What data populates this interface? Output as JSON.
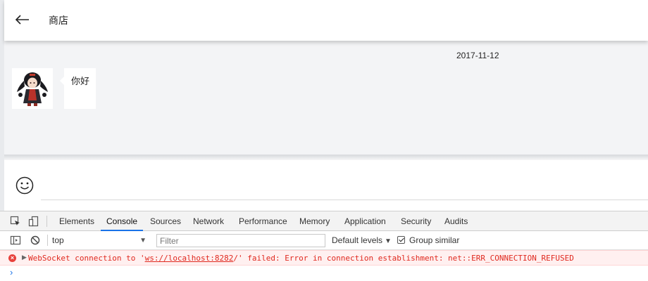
{
  "header": {
    "title": "商店"
  },
  "chat": {
    "date": "2017-11-12",
    "messages": [
      {
        "text": "你好"
      }
    ]
  },
  "devtools": {
    "tabs": [
      "Elements",
      "Console",
      "Sources",
      "Network",
      "Performance",
      "Memory",
      "Application",
      "Security",
      "Audits"
    ],
    "active_tab": "Console",
    "toolbar": {
      "context": "top",
      "filter_placeholder": "Filter",
      "levels": "Default levels",
      "group_similar": "Group similar",
      "group_similar_checked": true
    },
    "error": {
      "prefix": "WebSocket connection to '",
      "link": "ws://localhost:8282",
      "suffix": "/' failed: Error in connection establishment: net::ERR_CONNECTION_REFUSED"
    },
    "prompt": "›"
  },
  "colors": {
    "chat_bg": "#f3f4f6",
    "error_bg": "#fff0f0",
    "error_text": "#e0281e",
    "accent": "#1a73e8"
  }
}
